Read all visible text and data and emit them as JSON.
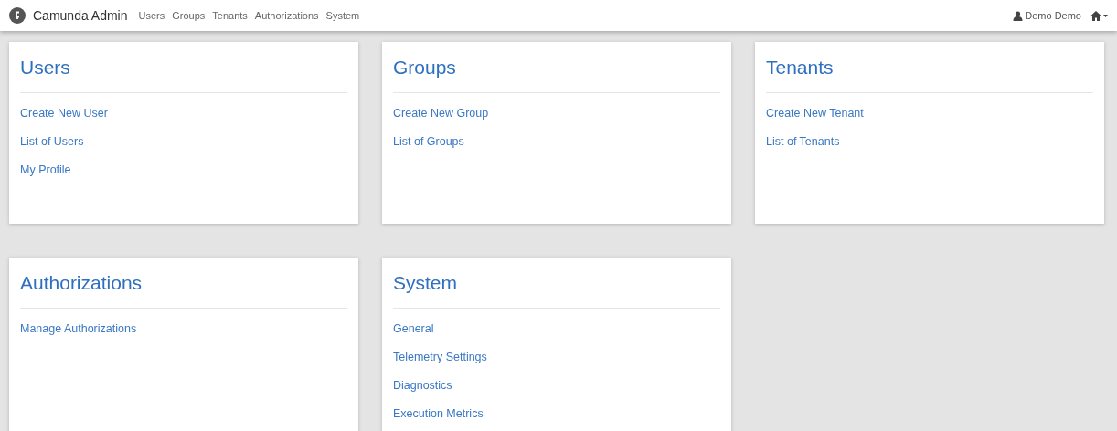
{
  "navbar": {
    "brand": "Camunda Admin",
    "links": [
      "Users",
      "Groups",
      "Tenants",
      "Authorizations",
      "System"
    ],
    "user": "Demo Demo"
  },
  "sections": [
    {
      "title": "Users",
      "links": [
        "Create New User",
        "List of Users",
        "My Profile"
      ]
    },
    {
      "title": "Groups",
      "links": [
        "Create New Group",
        "List of Groups"
      ]
    },
    {
      "title": "Tenants",
      "links": [
        "Create New Tenant",
        "List of Tenants"
      ]
    },
    {
      "title": "Authorizations",
      "links": [
        "Manage Authorizations"
      ]
    },
    {
      "title": "System",
      "links": [
        "General",
        "Telemetry Settings",
        "Diagnostics",
        "Execution Metrics"
      ]
    }
  ]
}
